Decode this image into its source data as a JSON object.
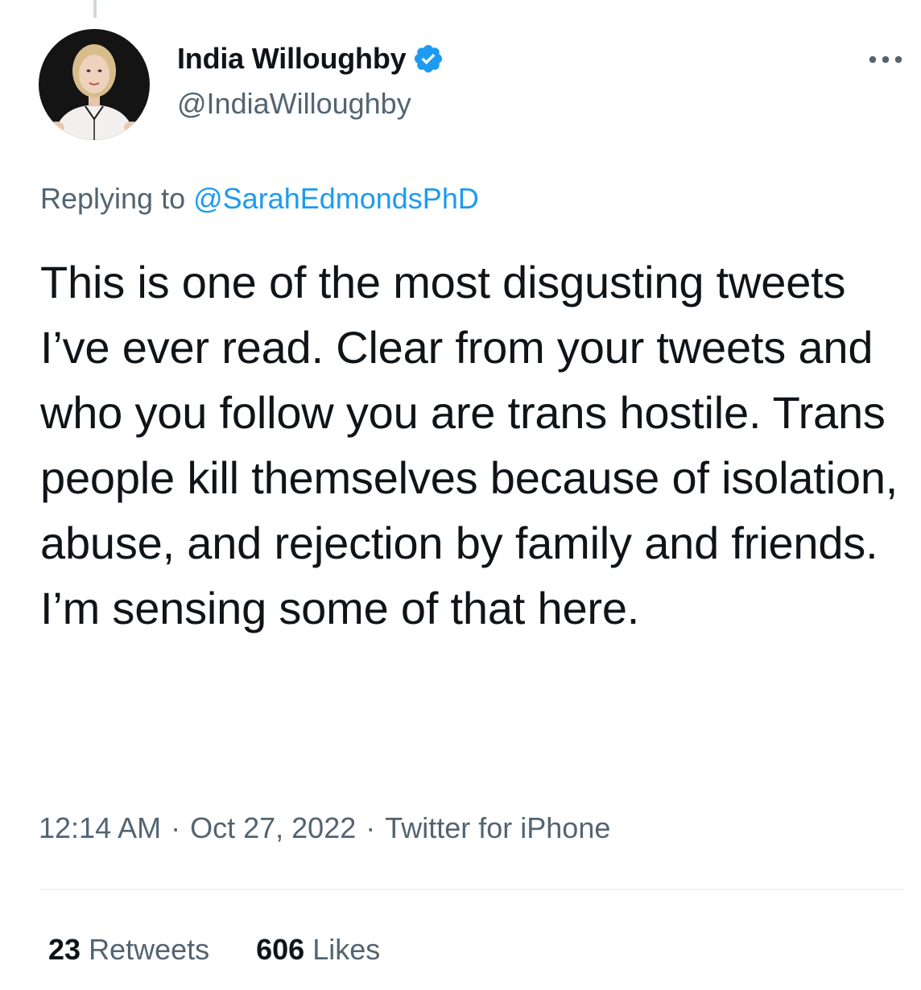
{
  "colors": {
    "accent": "#1d9bf0",
    "primary_text": "#0f1419",
    "secondary_text": "#536471",
    "divider": "#eff3f4"
  },
  "tweet": {
    "author": {
      "display_name": "India Willoughby",
      "handle": "@IndiaWilloughby",
      "verified": true,
      "verified_icon": "verified-badge-icon",
      "avatar_icon": "avatar"
    },
    "more_icon": "more-icon",
    "reply": {
      "prefix": "Replying to ",
      "to": "@SarahEdmondsPhD"
    },
    "text": "This is one of the most disgusting tweets I’ve ever read. Clear from your tweets and who you follow you are trans hostile. Trans people kill themselves because of isolation, abuse, and rejection by family and friends. I’m sensing some of that here.",
    "time": "12:14 AM",
    "separator": "·",
    "date": "Oct 27, 2022",
    "source": "Twitter for iPhone",
    "stats": {
      "retweets_count": "23",
      "retweets_label": "Retweets",
      "likes_count": "606",
      "likes_label": "Likes"
    }
  }
}
